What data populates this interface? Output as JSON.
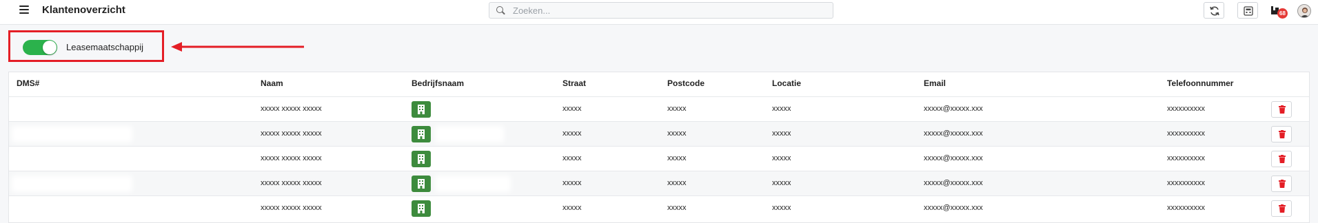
{
  "header": {
    "title": "Klantenoverzicht",
    "search_placeholder": "Zoeken...",
    "notification_count": "68"
  },
  "toggle": {
    "label": "Leasemaatschappij",
    "on": true
  },
  "colors": {
    "toggle_on": "#2bb24c",
    "highlight": "#e41e26",
    "building_button": "#3d8b3d",
    "delete_icon": "#e41e26",
    "badge": "#e53935"
  },
  "table": {
    "columns": [
      "DMS#",
      "Naam",
      "Bedrijfsnaam",
      "Straat",
      "Postcode",
      "Locatie",
      "Email",
      "Telefoonnummer"
    ],
    "rows": [
      {
        "naam": "xxxxx xxxxx xxxxx",
        "straat": "xxxxx",
        "postcode": "xxxxx",
        "locatie": "xxxxx",
        "email": "xxxxx@xxxxx.xxx",
        "telefoon": "xxxxxxxxxx"
      },
      {
        "naam": "xxxxx xxxxx xxxxx",
        "straat": "xxxxx",
        "postcode": "xxxxx",
        "locatie": "xxxxx",
        "email": "xxxxx@xxxxx.xxx",
        "telefoon": "xxxxxxxxxx"
      },
      {
        "naam": "xxxxx xxxxx xxxxx",
        "straat": "xxxxx",
        "postcode": "xxxxx",
        "locatie": "xxxxx",
        "email": "xxxxx@xxxxx.xxx",
        "telefoon": "xxxxxxxxxx"
      },
      {
        "naam": "xxxxx xxxxx xxxxx",
        "straat": "xxxxx",
        "postcode": "xxxxx",
        "locatie": "xxxxx",
        "email": "xxxxx@xxxxx.xxx",
        "telefoon": "xxxxxxxxxx"
      },
      {
        "naam": "xxxxx xxxxx xxxxx",
        "straat": "xxxxx",
        "postcode": "xxxxx",
        "locatie": "xxxxx",
        "email": "xxxxx@xxxxx.xxx",
        "telefoon": "xxxxxxxxxx"
      }
    ]
  },
  "icons": [
    "menu-icon",
    "search-icon",
    "refresh-icon",
    "calculator-icon",
    "inventory-icon",
    "user-avatar",
    "building-icon",
    "trash-icon",
    "arrow-annotation"
  ]
}
